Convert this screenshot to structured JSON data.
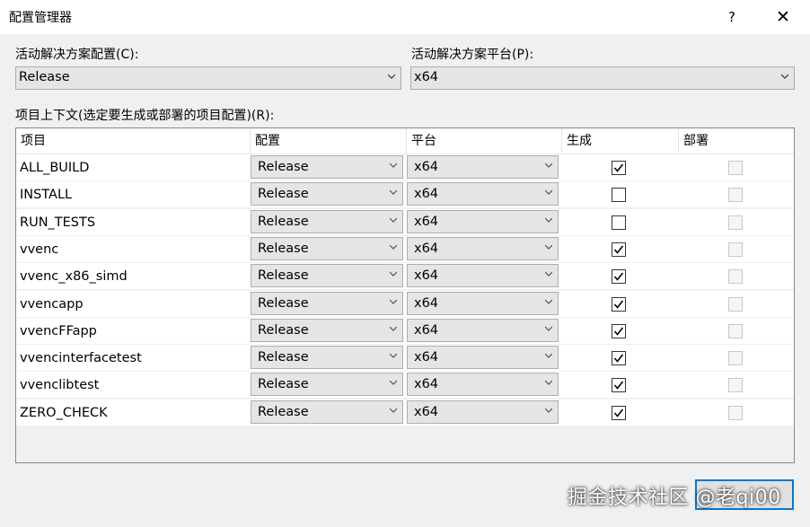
{
  "window": {
    "title": "配置管理器",
    "help_label": "?",
    "close_label": "✕"
  },
  "active_config": {
    "label": "活动解决方案配置(C):",
    "value": "Release"
  },
  "active_platform": {
    "label": "活动解决方案平台(P):",
    "value": "x64"
  },
  "project_context_label": "项目上下文(选定要生成或部署的项目配置)(R):",
  "columns": {
    "project": "项目",
    "config": "配置",
    "platform": "平台",
    "build": "生成",
    "deploy": "部署"
  },
  "rows": [
    {
      "project": "ALL_BUILD",
      "config": "Release",
      "platform": "x64",
      "build": true,
      "deploy": false
    },
    {
      "project": "INSTALL",
      "config": "Release",
      "platform": "x64",
      "build": false,
      "deploy": false
    },
    {
      "project": "RUN_TESTS",
      "config": "Release",
      "platform": "x64",
      "build": false,
      "deploy": false
    },
    {
      "project": "vvenc",
      "config": "Release",
      "platform": "x64",
      "build": true,
      "deploy": false
    },
    {
      "project": "vvenc_x86_simd",
      "config": "Release",
      "platform": "x64",
      "build": true,
      "deploy": false
    },
    {
      "project": "vvencapp",
      "config": "Release",
      "platform": "x64",
      "build": true,
      "deploy": false
    },
    {
      "project": "vvencFFapp",
      "config": "Release",
      "platform": "x64",
      "build": true,
      "deploy": false
    },
    {
      "project": "vvencinterfacetest",
      "config": "Release",
      "platform": "x64",
      "build": true,
      "deploy": false
    },
    {
      "project": "vvenclibtest",
      "config": "Release",
      "platform": "x64",
      "build": true,
      "deploy": false
    },
    {
      "project": "ZERO_CHECK",
      "config": "Release",
      "platform": "x64",
      "build": true,
      "deploy": false
    }
  ],
  "watermark": "掘金技术社区 @老qi00",
  "colors": {
    "dialog_bg": "#f0f0f0",
    "combo_bg": "#e5e5e5",
    "focus_border": "#0078d7"
  }
}
